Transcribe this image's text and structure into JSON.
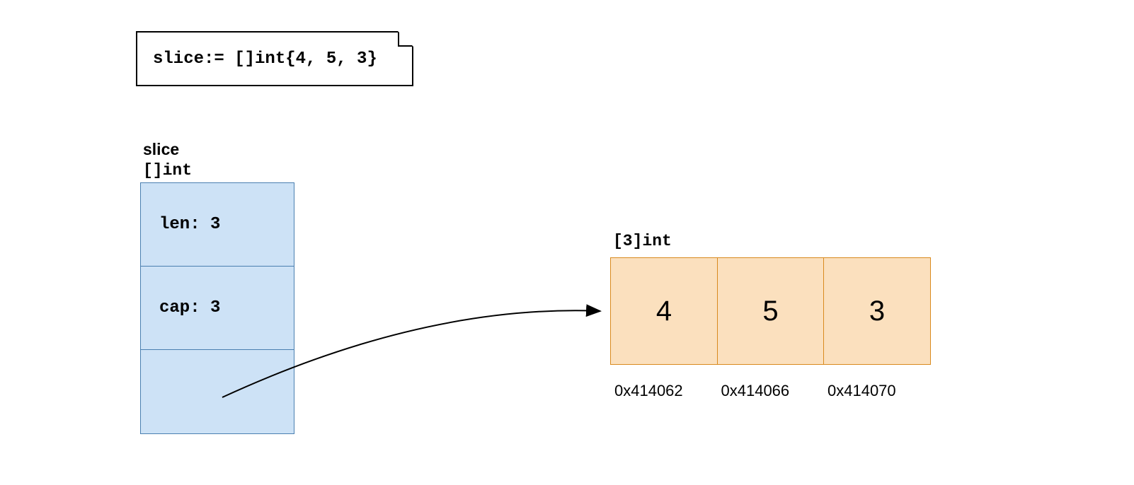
{
  "code_note": "slice:= []int{4, 5, 3}",
  "slice": {
    "title": "slice",
    "type": "[]int",
    "len_label": "len: 3",
    "cap_label": "cap: 3"
  },
  "array": {
    "type": "[3]int",
    "cells": [
      "4",
      "5",
      "3"
    ],
    "addresses": [
      "0x414062",
      "0x414066",
      "0x414070"
    ]
  }
}
